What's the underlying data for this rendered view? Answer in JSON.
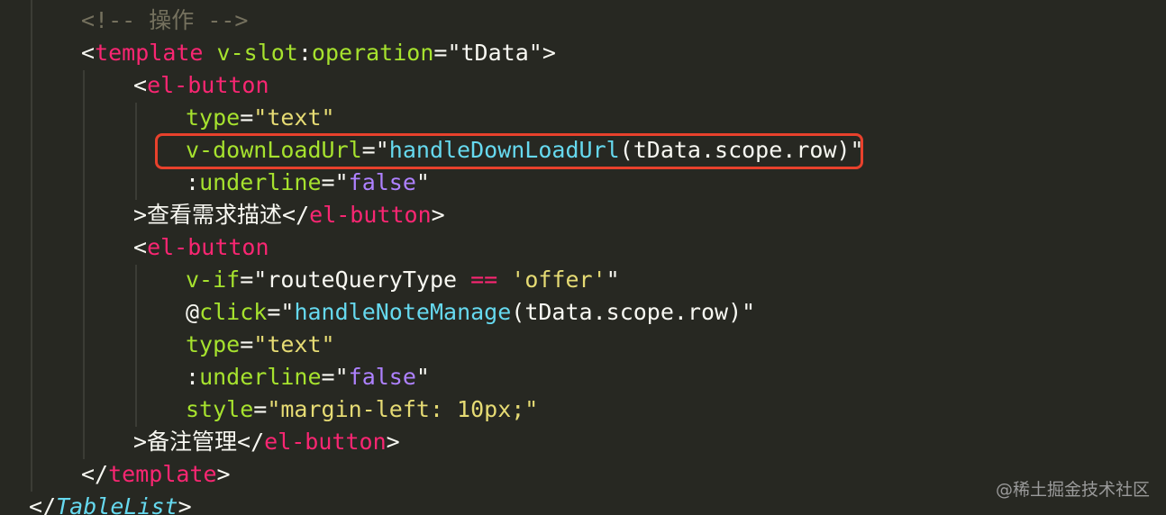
{
  "code": {
    "lines": [
      [
        {
          "t": "<!-- ",
          "c": "comment"
        },
        {
          "t": "操作",
          "c": "comment"
        },
        {
          "t": " -->",
          "c": "comment"
        }
      ],
      [
        {
          "t": "<",
          "c": "text"
        },
        {
          "t": "template",
          "c": "tag"
        },
        {
          "t": " ",
          "c": "text"
        },
        {
          "t": "v-slot",
          "c": "attr"
        },
        {
          "t": ":",
          "c": "text"
        },
        {
          "t": "operation",
          "c": "attr"
        },
        {
          "t": "=",
          "c": "text"
        },
        {
          "t": "\"tData\"",
          "c": "text"
        },
        {
          "t": ">",
          "c": "text"
        }
      ],
      [
        {
          "t": "<",
          "c": "text"
        },
        {
          "t": "el-button",
          "c": "tag"
        }
      ],
      [
        {
          "t": "type",
          "c": "attr"
        },
        {
          "t": "=",
          "c": "text"
        },
        {
          "t": "\"text\"",
          "c": "str"
        }
      ],
      [
        {
          "t": "v-downLoadUrl",
          "c": "attr"
        },
        {
          "t": "=",
          "c": "text"
        },
        {
          "t": "\"",
          "c": "text"
        },
        {
          "t": "handleDownLoadUrl",
          "c": "fn"
        },
        {
          "t": "(tData.scope.row)\"",
          "c": "text"
        }
      ],
      [
        {
          "t": ":",
          "c": "text"
        },
        {
          "t": "underline",
          "c": "attr"
        },
        {
          "t": "=",
          "c": "text"
        },
        {
          "t": "\"",
          "c": "text"
        },
        {
          "t": "false",
          "c": "kw"
        },
        {
          "t": "\"",
          "c": "text"
        }
      ],
      [
        {
          "t": ">查看需求描述</",
          "c": "text"
        },
        {
          "t": "el-button",
          "c": "tag"
        },
        {
          "t": ">",
          "c": "text"
        }
      ],
      [
        {
          "t": "<",
          "c": "text"
        },
        {
          "t": "el-button",
          "c": "tag"
        }
      ],
      [
        {
          "t": "v-if",
          "c": "attr"
        },
        {
          "t": "=",
          "c": "text"
        },
        {
          "t": "\"routeQueryType ",
          "c": "text"
        },
        {
          "t": "==",
          "c": "op"
        },
        {
          "t": " ",
          "c": "text"
        },
        {
          "t": "'offer'",
          "c": "str"
        },
        {
          "t": "\"",
          "c": "text"
        }
      ],
      [
        {
          "t": "@",
          "c": "text"
        },
        {
          "t": "click",
          "c": "attr"
        },
        {
          "t": "=",
          "c": "text"
        },
        {
          "t": "\"",
          "c": "text"
        },
        {
          "t": "handleNoteManage",
          "c": "fn"
        },
        {
          "t": "(tData.scope.row)\"",
          "c": "text"
        }
      ],
      [
        {
          "t": "type",
          "c": "attr"
        },
        {
          "t": "=",
          "c": "text"
        },
        {
          "t": "\"text\"",
          "c": "str"
        }
      ],
      [
        {
          "t": ":",
          "c": "text"
        },
        {
          "t": "underline",
          "c": "attr"
        },
        {
          "t": "=",
          "c": "text"
        },
        {
          "t": "\"",
          "c": "text"
        },
        {
          "t": "false",
          "c": "kw"
        },
        {
          "t": "\"",
          "c": "text"
        }
      ],
      [
        {
          "t": "style",
          "c": "attr"
        },
        {
          "t": "=",
          "c": "text"
        },
        {
          "t": "\"margin-left: 10px;\"",
          "c": "str"
        }
      ],
      [
        {
          "t": ">备注管理</",
          "c": "text"
        },
        {
          "t": "el-button",
          "c": "tag"
        },
        {
          "t": ">",
          "c": "text"
        }
      ],
      [
        {
          "t": "</",
          "c": "text"
        },
        {
          "t": "template",
          "c": "tag"
        },
        {
          "t": ">",
          "c": "text"
        }
      ],
      [
        {
          "t": "</",
          "c": "text"
        },
        {
          "t": "TableList",
          "c": "tag-italic"
        },
        {
          "t": ">",
          "c": "text"
        }
      ]
    ]
  },
  "colors": {
    "background": "#272822",
    "highlight_border": "#e8412c"
  },
  "watermark": "@稀土掘金技术社区"
}
